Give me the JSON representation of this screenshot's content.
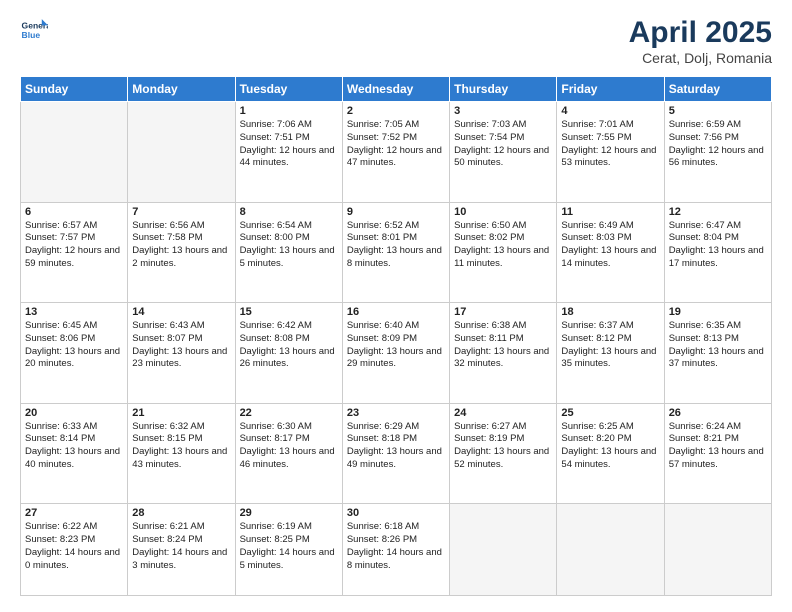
{
  "header": {
    "logo_line1": "General",
    "logo_line2": "Blue",
    "month_title": "April 2025",
    "location": "Cerat, Dolj, Romania"
  },
  "weekdays": [
    "Sunday",
    "Monday",
    "Tuesday",
    "Wednesday",
    "Thursday",
    "Friday",
    "Saturday"
  ],
  "weeks": [
    [
      {
        "day": "",
        "info": ""
      },
      {
        "day": "",
        "info": ""
      },
      {
        "day": "1",
        "info": "Sunrise: 7:06 AM\nSunset: 7:51 PM\nDaylight: 12 hours and 44 minutes."
      },
      {
        "day": "2",
        "info": "Sunrise: 7:05 AM\nSunset: 7:52 PM\nDaylight: 12 hours and 47 minutes."
      },
      {
        "day": "3",
        "info": "Sunrise: 7:03 AM\nSunset: 7:54 PM\nDaylight: 12 hours and 50 minutes."
      },
      {
        "day": "4",
        "info": "Sunrise: 7:01 AM\nSunset: 7:55 PM\nDaylight: 12 hours and 53 minutes."
      },
      {
        "day": "5",
        "info": "Sunrise: 6:59 AM\nSunset: 7:56 PM\nDaylight: 12 hours and 56 minutes."
      }
    ],
    [
      {
        "day": "6",
        "info": "Sunrise: 6:57 AM\nSunset: 7:57 PM\nDaylight: 12 hours and 59 minutes."
      },
      {
        "day": "7",
        "info": "Sunrise: 6:56 AM\nSunset: 7:58 PM\nDaylight: 13 hours and 2 minutes."
      },
      {
        "day": "8",
        "info": "Sunrise: 6:54 AM\nSunset: 8:00 PM\nDaylight: 13 hours and 5 minutes."
      },
      {
        "day": "9",
        "info": "Sunrise: 6:52 AM\nSunset: 8:01 PM\nDaylight: 13 hours and 8 minutes."
      },
      {
        "day": "10",
        "info": "Sunrise: 6:50 AM\nSunset: 8:02 PM\nDaylight: 13 hours and 11 minutes."
      },
      {
        "day": "11",
        "info": "Sunrise: 6:49 AM\nSunset: 8:03 PM\nDaylight: 13 hours and 14 minutes."
      },
      {
        "day": "12",
        "info": "Sunrise: 6:47 AM\nSunset: 8:04 PM\nDaylight: 13 hours and 17 minutes."
      }
    ],
    [
      {
        "day": "13",
        "info": "Sunrise: 6:45 AM\nSunset: 8:06 PM\nDaylight: 13 hours and 20 minutes."
      },
      {
        "day": "14",
        "info": "Sunrise: 6:43 AM\nSunset: 8:07 PM\nDaylight: 13 hours and 23 minutes."
      },
      {
        "day": "15",
        "info": "Sunrise: 6:42 AM\nSunset: 8:08 PM\nDaylight: 13 hours and 26 minutes."
      },
      {
        "day": "16",
        "info": "Sunrise: 6:40 AM\nSunset: 8:09 PM\nDaylight: 13 hours and 29 minutes."
      },
      {
        "day": "17",
        "info": "Sunrise: 6:38 AM\nSunset: 8:11 PM\nDaylight: 13 hours and 32 minutes."
      },
      {
        "day": "18",
        "info": "Sunrise: 6:37 AM\nSunset: 8:12 PM\nDaylight: 13 hours and 35 minutes."
      },
      {
        "day": "19",
        "info": "Sunrise: 6:35 AM\nSunset: 8:13 PM\nDaylight: 13 hours and 37 minutes."
      }
    ],
    [
      {
        "day": "20",
        "info": "Sunrise: 6:33 AM\nSunset: 8:14 PM\nDaylight: 13 hours and 40 minutes."
      },
      {
        "day": "21",
        "info": "Sunrise: 6:32 AM\nSunset: 8:15 PM\nDaylight: 13 hours and 43 minutes."
      },
      {
        "day": "22",
        "info": "Sunrise: 6:30 AM\nSunset: 8:17 PM\nDaylight: 13 hours and 46 minutes."
      },
      {
        "day": "23",
        "info": "Sunrise: 6:29 AM\nSunset: 8:18 PM\nDaylight: 13 hours and 49 minutes."
      },
      {
        "day": "24",
        "info": "Sunrise: 6:27 AM\nSunset: 8:19 PM\nDaylight: 13 hours and 52 minutes."
      },
      {
        "day": "25",
        "info": "Sunrise: 6:25 AM\nSunset: 8:20 PM\nDaylight: 13 hours and 54 minutes."
      },
      {
        "day": "26",
        "info": "Sunrise: 6:24 AM\nSunset: 8:21 PM\nDaylight: 13 hours and 57 minutes."
      }
    ],
    [
      {
        "day": "27",
        "info": "Sunrise: 6:22 AM\nSunset: 8:23 PM\nDaylight: 14 hours and 0 minutes."
      },
      {
        "day": "28",
        "info": "Sunrise: 6:21 AM\nSunset: 8:24 PM\nDaylight: 14 hours and 3 minutes."
      },
      {
        "day": "29",
        "info": "Sunrise: 6:19 AM\nSunset: 8:25 PM\nDaylight: 14 hours and 5 minutes."
      },
      {
        "day": "30",
        "info": "Sunrise: 6:18 AM\nSunset: 8:26 PM\nDaylight: 14 hours and 8 minutes."
      },
      {
        "day": "",
        "info": ""
      },
      {
        "day": "",
        "info": ""
      },
      {
        "day": "",
        "info": ""
      }
    ]
  ]
}
